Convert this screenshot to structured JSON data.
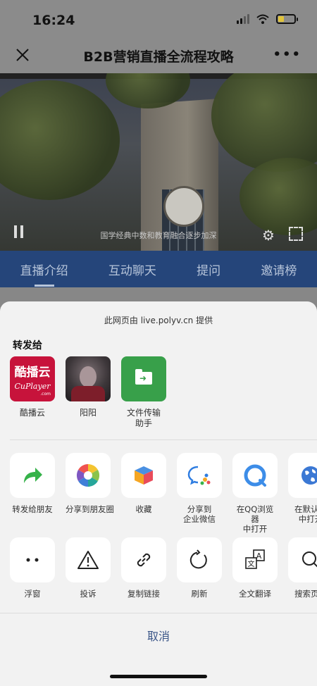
{
  "status": {
    "time": "16:24"
  },
  "nav": {
    "title": "B2B营销直播全流程攻略"
  },
  "video": {
    "caption": "国学经典中数和教育融合逐步加深"
  },
  "tabs": [
    "直播介绍",
    "互动聊天",
    "提问",
    "邀请榜"
  ],
  "sheet": {
    "source": "此网页由 live.polyv.cn 提供",
    "forward_label": "转发给",
    "contacts": [
      {
        "name": "酷播云",
        "avatar_text": "酷播云",
        "avatar_sub": "CuPlayer",
        "avatar_tag": ".com"
      },
      {
        "name": "阳阳"
      },
      {
        "name": "文件传输\n助手"
      }
    ],
    "actions_row1": [
      {
        "label": "转发给朋友",
        "icon": "share-arrow-icon"
      },
      {
        "label": "分享到朋友圈",
        "icon": "moments-icon"
      },
      {
        "label": "收藏",
        "icon": "favorite-cube-icon"
      },
      {
        "label": "分享到\n企业微信",
        "icon": "wecom-icon"
      },
      {
        "label": "在QQ浏览器\n中打开",
        "icon": "qq-browser-icon"
      },
      {
        "label": "在默认浏\n中打开",
        "icon": "globe-icon"
      }
    ],
    "actions_row2": [
      {
        "label": "浮窗",
        "icon": "float-window-icon"
      },
      {
        "label": "投诉",
        "icon": "warning-icon"
      },
      {
        "label": "复制链接",
        "icon": "link-icon"
      },
      {
        "label": "刷新",
        "icon": "refresh-icon"
      },
      {
        "label": "全文翻译",
        "icon": "translate-icon"
      },
      {
        "label": "搜索页面",
        "icon": "search-icon"
      }
    ],
    "cancel": "取消"
  },
  "colors": {
    "tab_bar": "#25457a",
    "cancel_text": "#3a5587",
    "sheet_bg": "#f2f2f2",
    "file_helper": "#38a04a",
    "kubo": "#c7133b"
  }
}
